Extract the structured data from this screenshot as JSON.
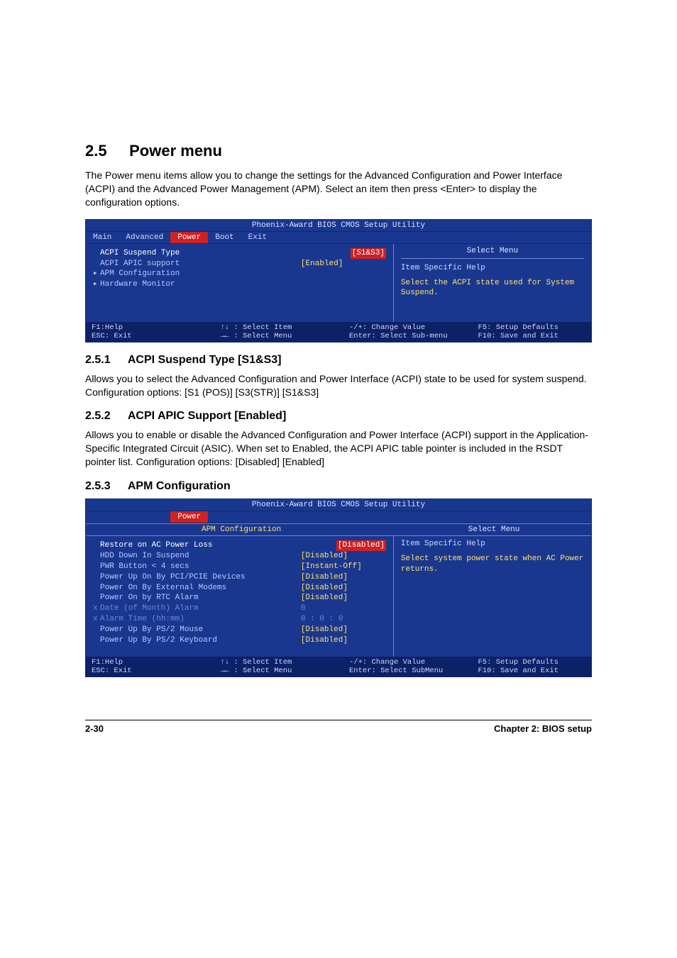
{
  "section": {
    "number": "2.5",
    "title": "Power menu",
    "intro": "The Power menu items allow you to change the settings for the Advanced Configuration and Power Interface (ACPI) and the Advanced Power Management (APM). Select an item then press <Enter> to display the configuration options."
  },
  "bios1": {
    "utility_title": "Phoenix-Award BIOS CMOS Setup Utility",
    "tabs": [
      "Main",
      "Advanced",
      "Power",
      "Boot",
      "Exit"
    ],
    "active_tab": "Power",
    "rows": [
      {
        "label": "ACPI Suspend Type",
        "value": "[S1&S3]",
        "highlight": true,
        "tri": false,
        "sel": true
      },
      {
        "label": "ACPI APIC support",
        "value": "[Enabled]",
        "highlight": false,
        "tri": false,
        "val_yellow": true
      },
      {
        "label": "APM Configuration",
        "value": "",
        "highlight": false,
        "tri": true
      },
      {
        "label": "Hardware Monitor",
        "value": "",
        "highlight": false,
        "tri": true
      }
    ],
    "right_title": "Select Menu",
    "help_head": "Item Specific Help",
    "help_body": "Select the ACPI state used for System Suspend.",
    "footer": {
      "c1a": "F1:Help",
      "c1b": "ESC: Exit",
      "c2a": "↑↓ : Select Item",
      "c2b": "→← : Select Menu",
      "c3a": "-/+: Change Value",
      "c3b": "Enter: Select Sub-menu",
      "c4a": "F5: Setup Defaults",
      "c4b": "F10: Save and Exit"
    }
  },
  "sub1": {
    "number": "2.5.1",
    "title": "ACPI Suspend Type [S1&S3]",
    "p1": "Allows you to select the Advanced Configuration and Power Interface (ACPI) state to be used for system suspend.",
    "p2": "Configuration options: [S1 (POS)] [S3(STR)] [S1&S3]"
  },
  "sub2": {
    "number": "2.5.2",
    "title": "ACPI APIC Support [Enabled]",
    "p1": "Allows you to enable or disable the Advanced Configuration and Power Interface (ACPI) support in the Application-Specific Integrated Circuit (ASIC). When set to Enabled, the ACPI APIC table pointer is included in the RSDT pointer list. Configuration options: [Disabled] [Enabled]"
  },
  "sub3": {
    "number": "2.5.3",
    "title": "APM Configuration"
  },
  "bios2": {
    "utility_title": "Phoenix-Award BIOS CMOS Setup Utility",
    "tabs_blank": [
      "",
      "",
      "Power",
      "",
      ""
    ],
    "subheader": "APM Configuration",
    "rows": [
      {
        "label": "Restore on AC Power Loss",
        "value": "[Disabled]",
        "highlight": true,
        "sel": true
      },
      {
        "label": "HDD Down  In Suspend",
        "value": "[Disabled]"
      },
      {
        "label": "PWR Button < 4 secs",
        "value": "[Instant-Off]"
      },
      {
        "label": "Power Up On By PCI/PCIE Devices",
        "value": "[Disabled]"
      },
      {
        "label": "Power On By External Modems",
        "value": "[Disabled]"
      },
      {
        "label": "Power On by RTC Alarm",
        "value": "[Disabled]"
      },
      {
        "label": "Date (of Month) Alarm",
        "value": " 0",
        "grey": true,
        "x": true
      },
      {
        "label": "Alarm Time (hh:mm)",
        "value": "0 : 0 : 0",
        "grey": true,
        "x": true
      },
      {
        "label": "Power Up By PS/2 Mouse",
        "value": "[Disabled]"
      },
      {
        "label": "Power Up By PS/2 Keyboard",
        "value": "[Disabled]"
      }
    ],
    "right_title": "Select Menu",
    "help_head": "Item Specific Help",
    "help_body": "Select system power state when AC Power returns.",
    "footer": {
      "c1a": "F1:Help",
      "c1b": "ESC: Exit",
      "c2a": "↑↓ : Select Item",
      "c2b": "→← : Select Menu",
      "c3a": "-/+: Change Value",
      "c3b": "Enter: Select SubMenu",
      "c4a": "F5: Setup Defaults",
      "c4b": "F10: Save and Exit"
    }
  },
  "page_footer": {
    "left": "2-30",
    "right": "Chapter 2: BIOS setup"
  }
}
